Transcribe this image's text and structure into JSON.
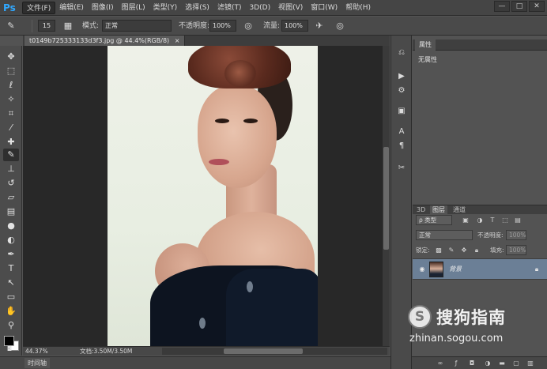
{
  "app": {
    "logo": "Ps"
  },
  "menu": [
    "文件(F)",
    "编辑(E)",
    "图像(I)",
    "图层(L)",
    "类型(Y)",
    "选择(S)",
    "滤镜(T)",
    "3D(D)",
    "视图(V)",
    "窗口(W)",
    "帮助(H)"
  ],
  "window_buttons": [
    "—",
    "□",
    "✕"
  ],
  "options": {
    "brush_size": "15",
    "mode_label": "模式:",
    "mode_value": "正常",
    "opacity_label": "不透明度:",
    "opacity_value": "100%",
    "flow_label": "流量:",
    "flow_value": "100%"
  },
  "document": {
    "tab_title": "t0149b725333133d3f3.jpg @ 44.4%(RGB/8)",
    "tab_close": "×"
  },
  "status": {
    "zoom": "44.37%",
    "doc_info": "文档:3.50M/3.50M"
  },
  "timeline": {
    "label": "时间轴"
  },
  "properties": {
    "tab": "属性",
    "body": "无属性"
  },
  "layers": {
    "tabs": [
      "3D",
      "图层",
      "通道"
    ],
    "filter_type": "ρ 类型",
    "blend_mode": "正常",
    "opacity_label": "不透明度:",
    "opacity_value": "100%",
    "lock_label": "锁定:",
    "fill_label": "填充:",
    "fill_value": "100%",
    "layer_name": "背景"
  },
  "watermark": {
    "title": "搜狗指南",
    "url": "zhinan.sogou.com"
  },
  "icons": {
    "left_tools": [
      "move-tool-icon",
      "marquee-tool-icon",
      "lasso-tool-icon",
      "quick-select-icon",
      "crop-tool-icon",
      "eyedropper-icon",
      "spot-heal-icon",
      "brush-tool-icon",
      "clone-stamp-icon",
      "history-brush-icon",
      "eraser-icon",
      "gradient-icon",
      "blur-tool-icon",
      "dodge-tool-icon",
      "pen-tool-icon",
      "type-tool-icon",
      "path-select-icon",
      "rectangle-tool-icon",
      "hand-tool-icon",
      "zoom-tool-icon"
    ],
    "accent": "#31a8ff",
    "selected_layer": "#6b7f96"
  }
}
